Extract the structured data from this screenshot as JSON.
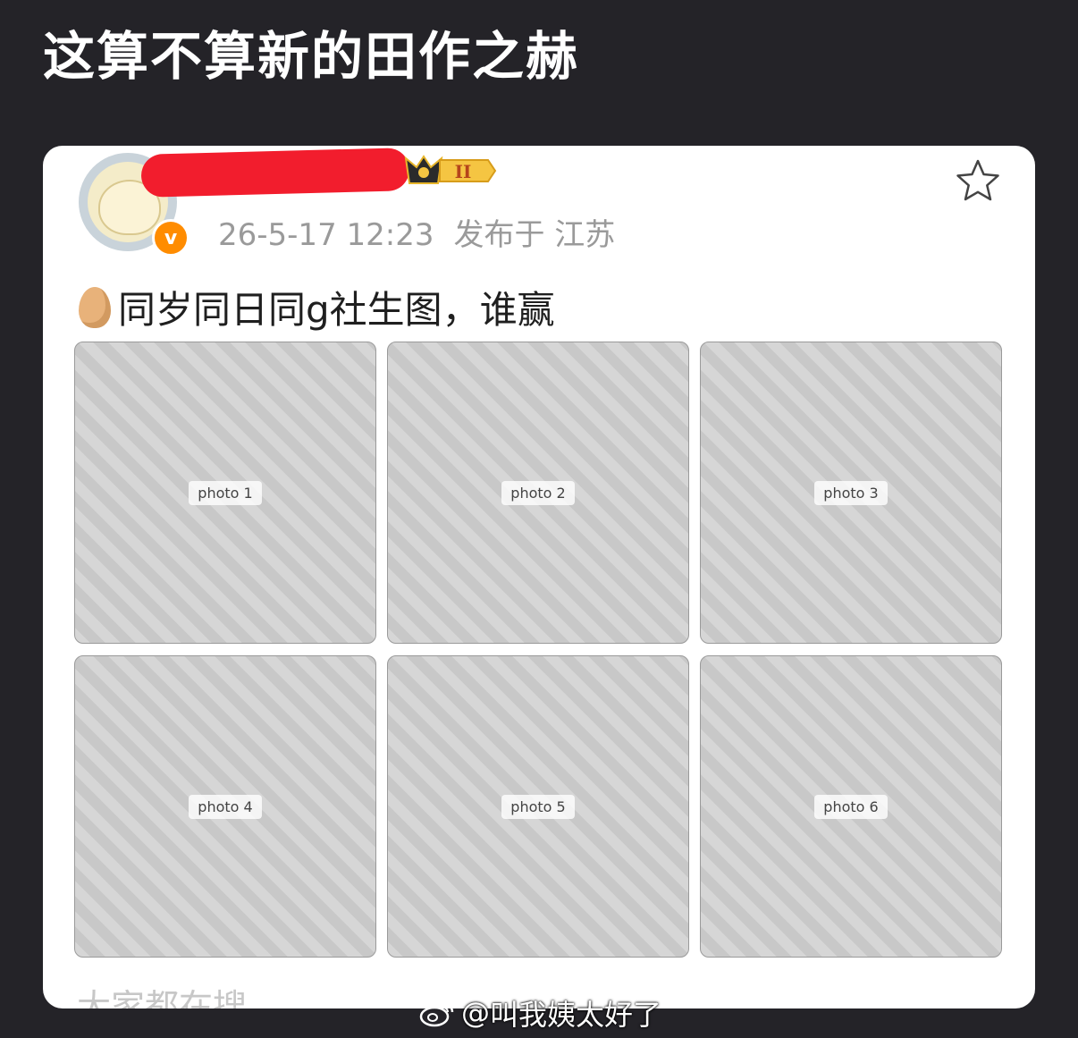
{
  "page_title": "这算不算新的田作之赫",
  "post": {
    "timestamp": "26-5-17 12:23",
    "location": "发布于 江苏",
    "verified_badge": "v",
    "level_badge": "II",
    "emoji": "egg",
    "text": "同岁同日同g社生图，谁赢",
    "photos": [
      {
        "label": "photo 1"
      },
      {
        "label": "photo 2"
      },
      {
        "label": "photo 3"
      },
      {
        "label": "photo 4"
      },
      {
        "label": "photo 5"
      },
      {
        "label": "photo 6"
      }
    ],
    "search_hint": "大家都在搜"
  },
  "watermark": {
    "prefix": "@",
    "text": "叫我姨太好了"
  },
  "colors": {
    "background": "#242328",
    "card": "#ffffff",
    "redaction": "#f21d2d",
    "verified": "#ff8c00",
    "badge_gold": "#f5c542"
  },
  "icons": {
    "star": "star-outline-icon",
    "weibo": "weibo-logo-icon",
    "verified": "verified-v-icon",
    "crown": "crown-icon"
  }
}
